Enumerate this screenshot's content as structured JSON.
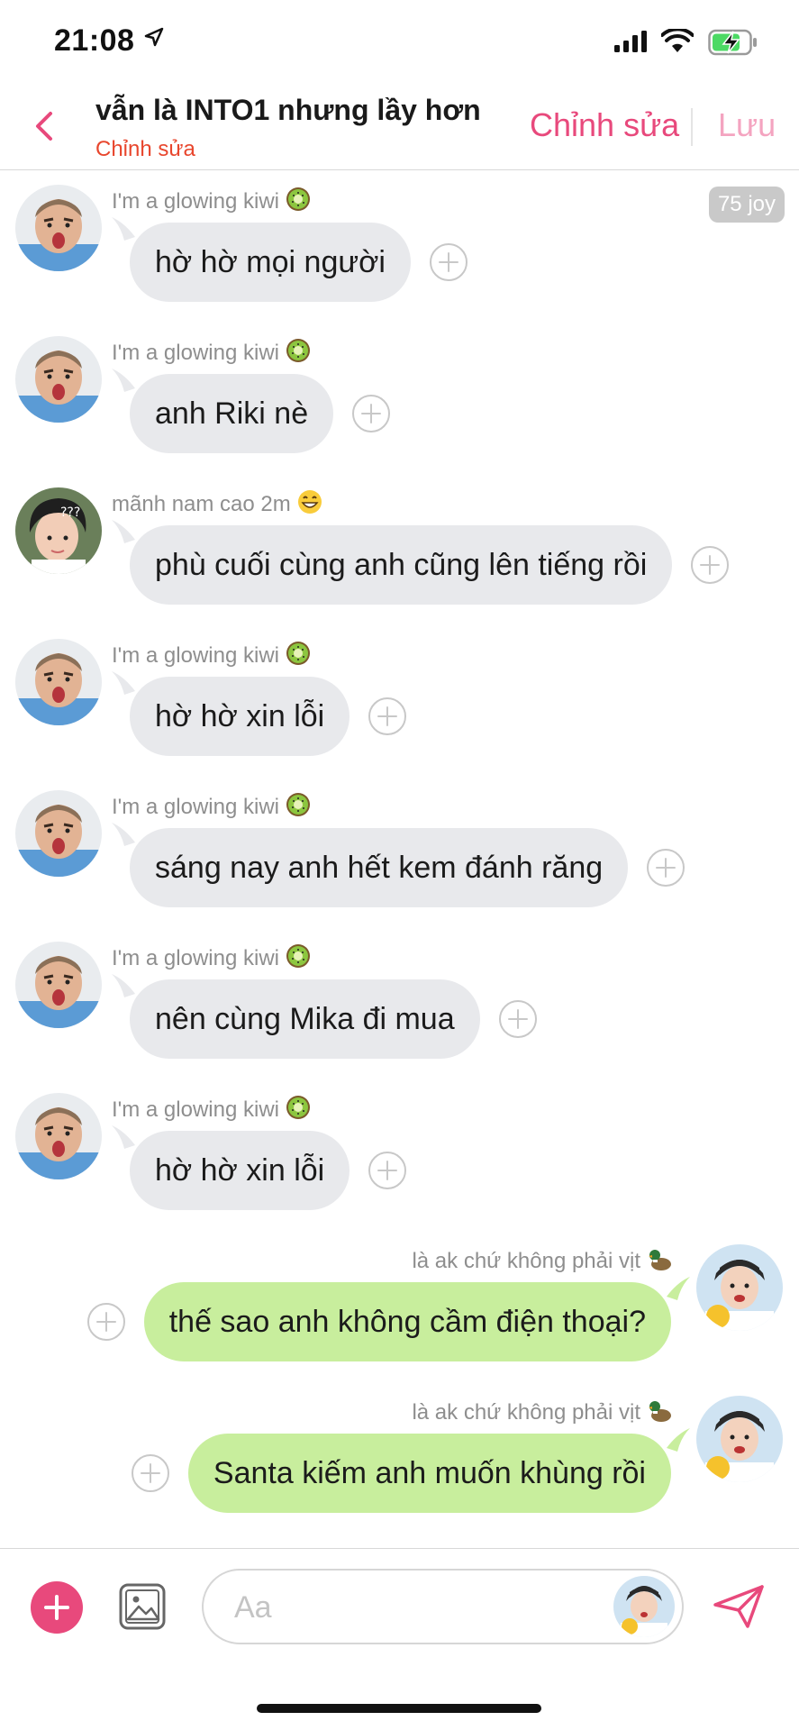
{
  "status_bar": {
    "time": "21:08"
  },
  "header": {
    "title": "vẫn là INTO1 nhưng lầy hơn",
    "subtitle": "Chỉnh sửa",
    "edit_label": "Chỉnh sửa",
    "save_label": "Lưu"
  },
  "joy_badge": "75 joy",
  "messages": [
    {
      "side": "left",
      "sender": "I'm a glowing kiwi",
      "text": "hờ hờ mọi người",
      "avatar": "bald-man-avatar",
      "emoji": "kiwi-emoji"
    },
    {
      "side": "left",
      "sender": "I'm a glowing kiwi",
      "text": "anh Riki nè",
      "avatar": "bald-man-avatar",
      "emoji": "kiwi-emoji"
    },
    {
      "side": "left",
      "sender": "mãnh nam cao 2m",
      "text": "phù cuối cùng anh cũng lên tiếng rồi",
      "avatar": "boy-question-avatar",
      "emoji": "grin-emoji"
    },
    {
      "side": "left",
      "sender": "I'm a glowing kiwi",
      "text": "hờ hờ xin lỗi",
      "avatar": "bald-man-avatar",
      "emoji": "kiwi-emoji"
    },
    {
      "side": "left",
      "sender": "I'm a glowing kiwi",
      "text": "sáng nay anh hết kem đánh răng",
      "avatar": "bald-man-avatar",
      "emoji": "kiwi-emoji"
    },
    {
      "side": "left",
      "sender": "I'm a glowing kiwi",
      "text": "nên cùng Mika đi mua",
      "avatar": "bald-man-avatar",
      "emoji": "kiwi-emoji"
    },
    {
      "side": "left",
      "sender": "I'm a glowing kiwi",
      "text": "hờ hờ xin lỗi",
      "avatar": "bald-man-avatar",
      "emoji": "kiwi-emoji"
    },
    {
      "side": "right",
      "sender": "là ak chứ không phải vịt",
      "text": "thế sao anh không cầm điện thoại?",
      "avatar": "boy-yellow-avatar",
      "emoji": "duck-emoji"
    },
    {
      "side": "right",
      "sender": "là ak chứ không phải vịt",
      "text": "Santa kiếm anh muốn khùng rồi",
      "avatar": "boy-yellow-avatar",
      "emoji": "duck-emoji"
    }
  ],
  "composer": {
    "placeholder": "Aa"
  },
  "colors": {
    "accent": "#e8497c",
    "left_bubble": "#e8e9ec",
    "right_bubble": "#c8ee9d",
    "subtitle": "#e8462d"
  }
}
